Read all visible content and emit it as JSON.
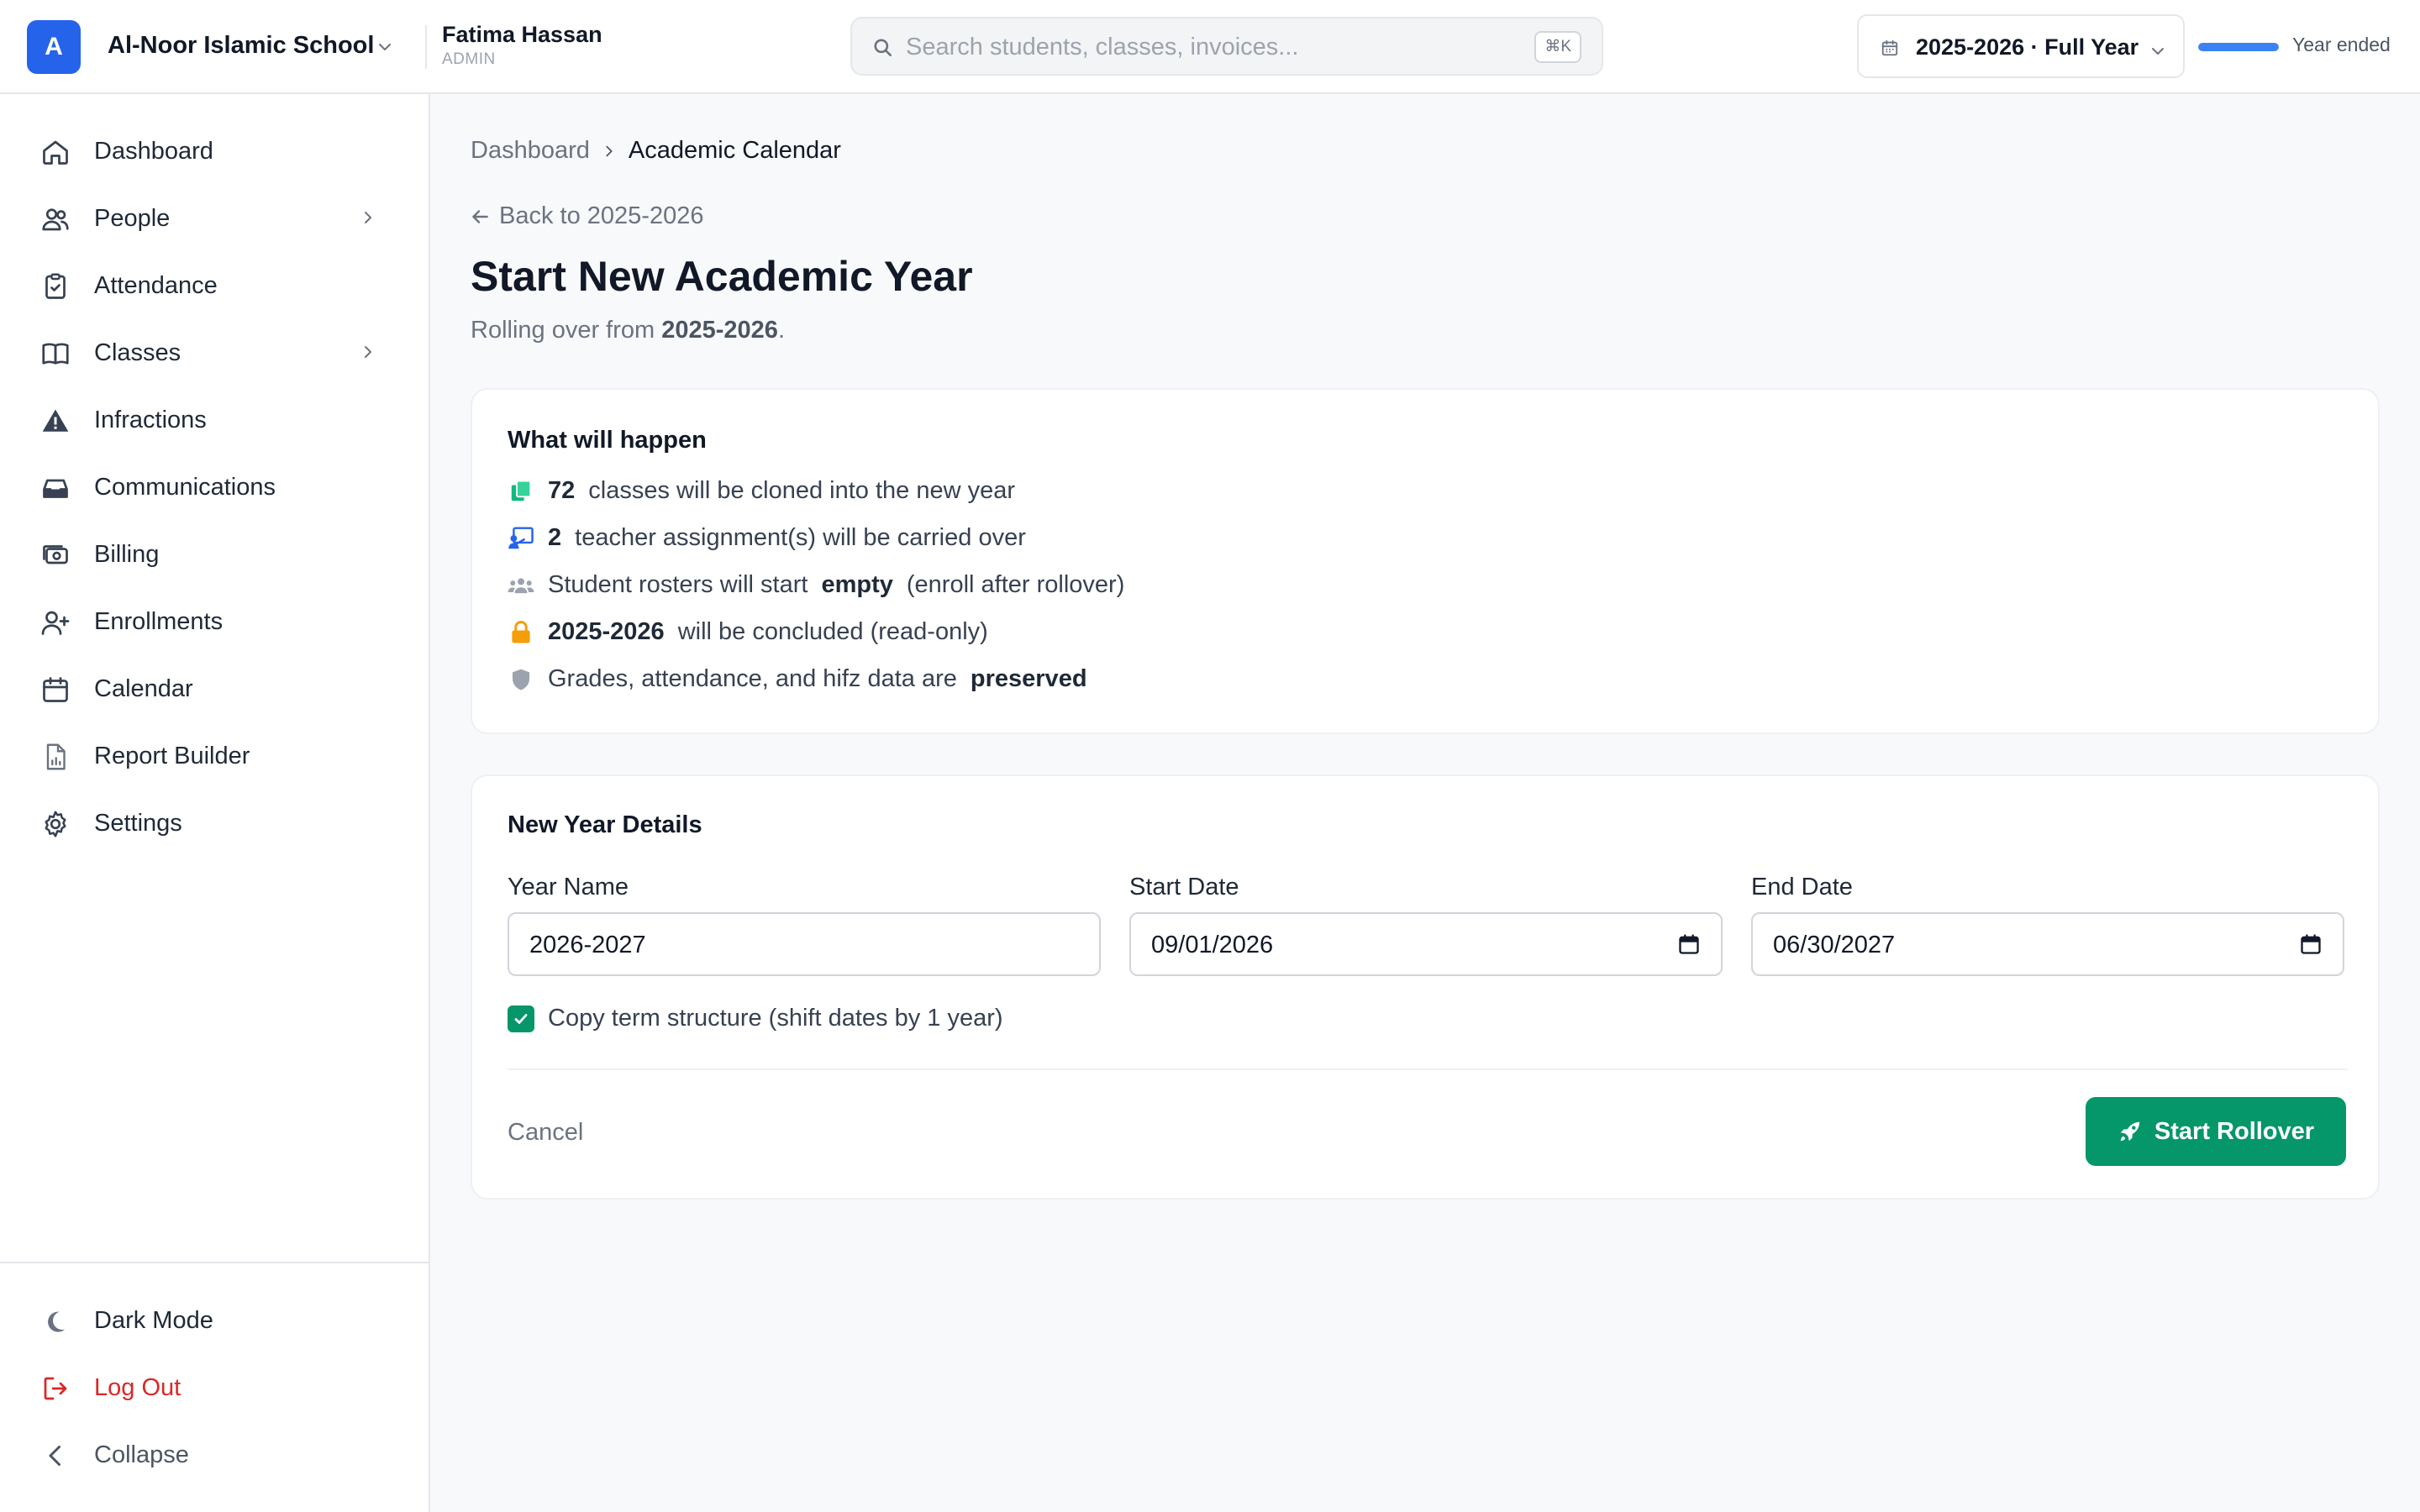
{
  "header": {
    "org_initial": "A",
    "org_name": "Al-Noor Islamic School",
    "user_name": "Fatima Hassan",
    "user_role": "ADMIN",
    "search_placeholder": "Search students, classes, invoices...",
    "search_shortcut": "⌘K",
    "year_selector": "2025-2026 · Full Year",
    "year_progress_percent": 100,
    "year_status": "Year ended"
  },
  "sidebar": {
    "items": [
      {
        "label": "Dashboard",
        "icon": "home-icon"
      },
      {
        "label": "People",
        "icon": "people-icon",
        "has_submenu": true
      },
      {
        "label": "Attendance",
        "icon": "clipboard-check-icon"
      },
      {
        "label": "Classes",
        "icon": "book-icon",
        "has_submenu": true
      },
      {
        "label": "Infractions",
        "icon": "warning-icon"
      },
      {
        "label": "Communications",
        "icon": "inbox-icon"
      },
      {
        "label": "Billing",
        "icon": "money-icon"
      },
      {
        "label": "Enrollments",
        "icon": "user-plus-icon"
      },
      {
        "label": "Calendar",
        "icon": "calendar-icon"
      },
      {
        "label": "Report Builder",
        "icon": "report-icon"
      },
      {
        "label": "Settings",
        "icon": "gear-icon"
      }
    ],
    "bottom": {
      "dark_mode": "Dark Mode",
      "logout": "Log Out",
      "collapse": "Collapse"
    }
  },
  "breadcrumb": {
    "parent": "Dashboard",
    "current": "Academic Calendar"
  },
  "page": {
    "back_link": "Back to 2025-2026",
    "title": "Start New Academic Year",
    "subtitle_prefix": "Rolling over from ",
    "subtitle_year": "2025-2026",
    "subtitle_suffix": "."
  },
  "what_will_happen": {
    "title": "What will happen",
    "classes_count": "72",
    "classes_text": "classes will be cloned into the new year",
    "teachers_count": "2",
    "teachers_text": "teacher assignment(s) will be carried over",
    "rosters_prefix": "Student rosters will start",
    "rosters_bold": "empty",
    "rosters_suffix": "(enroll after rollover)",
    "concluded_year": "2025-2026",
    "concluded_text": "will be concluded (read-only)",
    "preserved_prefix": "Grades, attendance, and hifz data are",
    "preserved_bold": "preserved"
  },
  "new_year": {
    "title": "New Year Details",
    "year_name_label": "Year Name",
    "year_name_value": "2026-2027",
    "start_date_label": "Start Date",
    "start_date_value": "09/01/2026",
    "end_date_label": "End Date",
    "end_date_value": "06/30/2027",
    "copy_terms_label": "Copy term structure (shift dates by 1 year)",
    "copy_terms_checked": true,
    "cancel_label": "Cancel",
    "submit_label": "Start Rollover"
  },
  "colors": {
    "brand_blue": "#2563eb",
    "primary_green": "#059669",
    "danger_red": "#dc2626",
    "warning_amber": "#f59e0b"
  }
}
